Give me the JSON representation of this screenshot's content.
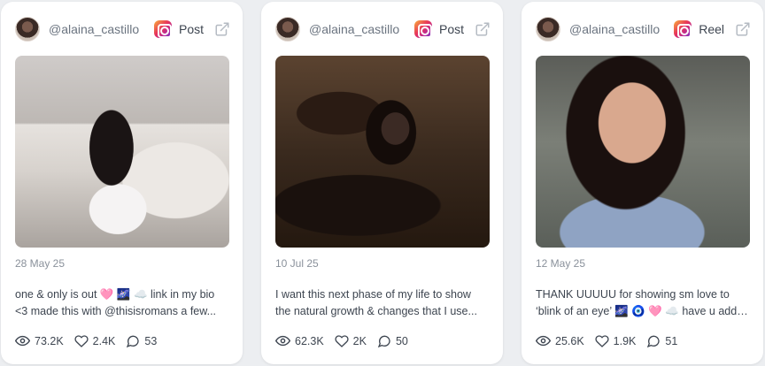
{
  "posts": [
    {
      "handle": "@alaina_castillo",
      "type": "Post",
      "date": "28 May 25",
      "caption_line1": "one & only is out 🩷 🌌 ☁️ link in my bio",
      "caption_line2": "<3 made this with @thisisromans a few...",
      "views": "73.2K",
      "likes": "2.4K",
      "comments": "53"
    },
    {
      "handle": "@alaina_castillo",
      "type": "Post",
      "date": "10 Jul 25",
      "caption_line1": "I want this next phase of my life to show",
      "caption_line2": "the natural growth & changes that I use...",
      "views": "62.3K",
      "likes": "2K",
      "comments": "50"
    },
    {
      "handle": "@alaina_castillo",
      "type": "Reel",
      "date": "12 May 25",
      "caption_line1": "THANK UUUUU for showing sm love to",
      "caption_line2": "‘blink of an eye’ 🌌 🧿 🩷 ☁️ have u adde...",
      "views": "25.6K",
      "likes": "1.9K",
      "comments": "51"
    }
  ],
  "colors": {
    "card_bg": "#ffffff",
    "page_bg": "#eceef1",
    "muted_text": "#8a919b",
    "body_text": "#3d4550"
  },
  "icons": [
    "instagram-icon",
    "external-link-icon",
    "eye-icon",
    "heart-icon",
    "comment-icon"
  ]
}
